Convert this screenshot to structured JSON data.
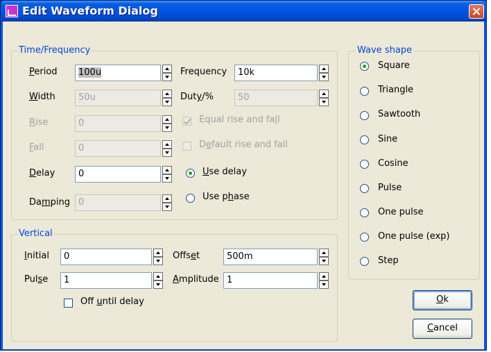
{
  "window": {
    "title": "Edit Waveform Dialog"
  },
  "time_frequency": {
    "legend": "Time/Frequency",
    "period": {
      "label_u": "P",
      "label_rest": "eriod",
      "value": "100u"
    },
    "width": {
      "label_u": "W",
      "label_rest": "idth",
      "value": "50u"
    },
    "rise": {
      "label_u": "R",
      "label_rest": "ise",
      "value": "0"
    },
    "fall": {
      "label_u": "F",
      "label_rest": "all",
      "value": "0"
    },
    "delay": {
      "label_u": "D",
      "label_rest": "elay",
      "value": "0"
    },
    "damping": {
      "label_pre": "Da",
      "label_u": "m",
      "label_rest": "ping",
      "value": "0"
    },
    "frequency": {
      "label": "Frequency",
      "value": "10k"
    },
    "duty": {
      "label_pre": "Dut",
      "label_u": "y",
      "label_rest": "/%",
      "value": "50"
    },
    "equal_rise_fall": {
      "label_pre": "Equal rise and fa",
      "label_u": "l",
      "label_rest": "l",
      "checked": true
    },
    "default_rise_fall": {
      "label_pre": "D",
      "label_u": "e",
      "label_rest": "fault rise and fall",
      "checked": false
    },
    "use_delay": {
      "label_u": "U",
      "label_rest": "se delay",
      "selected": true
    },
    "use_phase": {
      "label_pre": "Use p",
      "label_u": "h",
      "label_rest": "ase",
      "selected": false
    }
  },
  "vertical": {
    "legend": "Vertical",
    "initial": {
      "label_u": "I",
      "label_rest": "nitial",
      "value": "0"
    },
    "pulse": {
      "label_pre": "Pul",
      "label_u": "s",
      "label_rest": "e",
      "value": "1"
    },
    "offset": {
      "label_pre": "Offs",
      "label_u": "e",
      "label_rest": "t",
      "value": "500m"
    },
    "amplitude": {
      "label_u": "A",
      "label_rest": "mplitude",
      "value": "1"
    },
    "off_until_delay": {
      "label_pre": "Off ",
      "label_u": "u",
      "label_rest": "ntil delay",
      "checked": false
    }
  },
  "wave_shape": {
    "legend": "Wave shape",
    "options": [
      {
        "label": "Square",
        "selected": true
      },
      {
        "label": "Triangle",
        "selected": false
      },
      {
        "label": "Sawtooth",
        "selected": false
      },
      {
        "label": "Sine",
        "selected": false
      },
      {
        "label": "Cosine",
        "selected": false
      },
      {
        "label": "Pulse",
        "selected": false
      },
      {
        "label": "One pulse",
        "selected": false
      },
      {
        "label": "One pulse (exp)",
        "selected": false
      },
      {
        "label": "Step",
        "selected": false
      }
    ]
  },
  "buttons": {
    "ok": {
      "label_u": "O",
      "label_rest": "k"
    },
    "cancel": {
      "label_u": "C",
      "label_rest": "ancel"
    }
  },
  "colors": {
    "titlebar": "#0054e3",
    "dialog_bg": "#ece9d8",
    "group_legend": "#0046d5",
    "radio_dot": "#21a121"
  }
}
